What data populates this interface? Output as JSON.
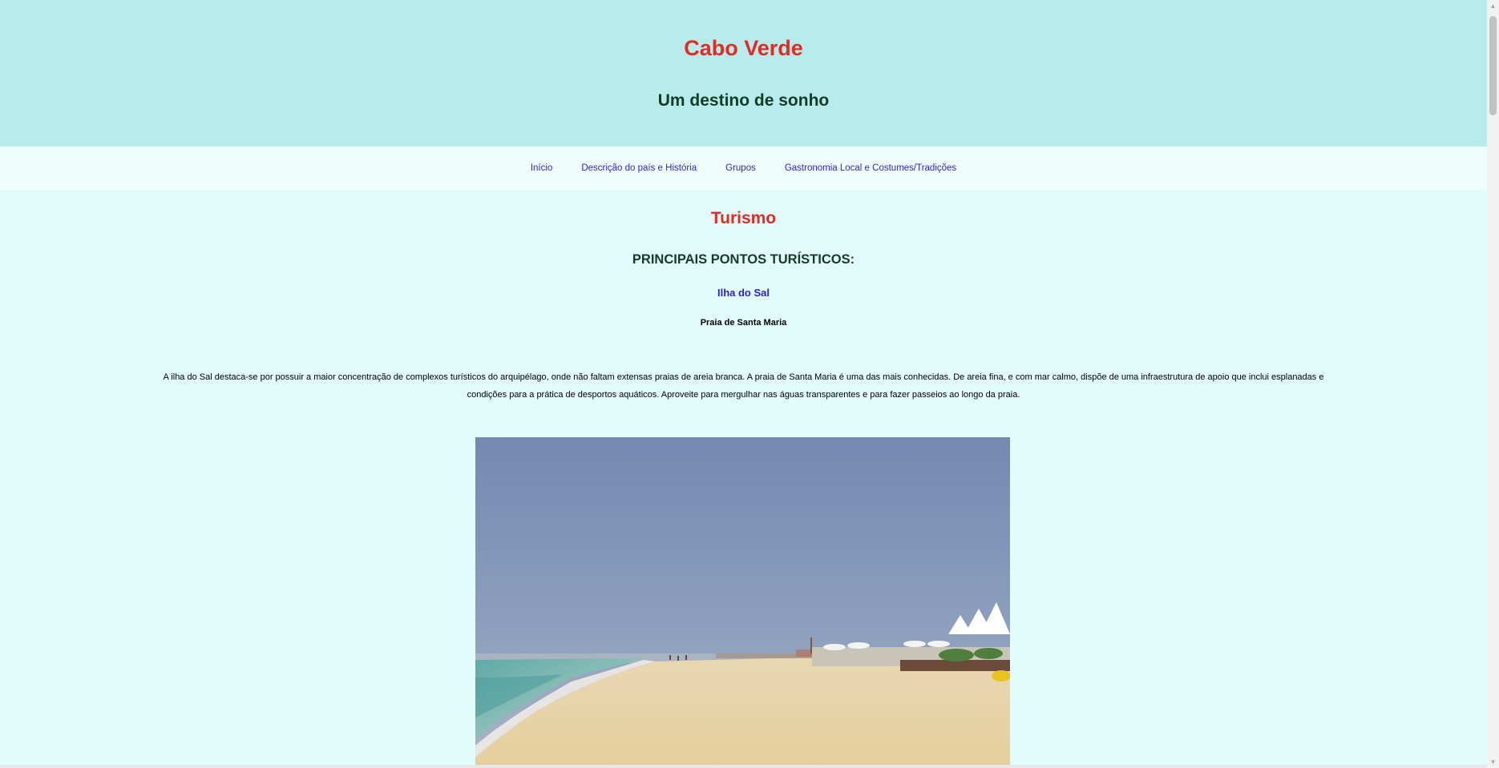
{
  "header": {
    "title": "Cabo Verde",
    "subtitle": "Um destino de sonho"
  },
  "nav": {
    "items": [
      {
        "label": "Início"
      },
      {
        "label": "Descrição do país e História"
      },
      {
        "label": "Grupos"
      },
      {
        "label": "Gastronomia Local e Costumes/Tradições"
      }
    ]
  },
  "main": {
    "title": "Turismo",
    "section_heading": "PRINCIPAIS PONTOS TURÍSTICOS:",
    "island_link": "Ilha do Sal",
    "beach_name": "Praia de Santa Maria",
    "description": "A ilha do Sal destaca-se por possuir a maior concentração de complexos turísticos do arquipélago, onde não faltam extensas praias de areia branca. A praia de Santa Maria é uma das mais conhecidas. De areia fina, e com mar calmo, dispõe de uma infraestrutura de apoio que inclui esplanadas e condições para a prática de desportos aquáticos. Aproveite para mergulhar nas águas transparentes e para fazer passeios ao longo da praia."
  },
  "colors": {
    "header_bg": "#b8ecec",
    "nav_bg": "#effefd",
    "page_bg": "#e2fbfb",
    "title_red": "#e22b24",
    "heading_dark_green": "#133b26",
    "link_blue": "#2b1fd6"
  }
}
